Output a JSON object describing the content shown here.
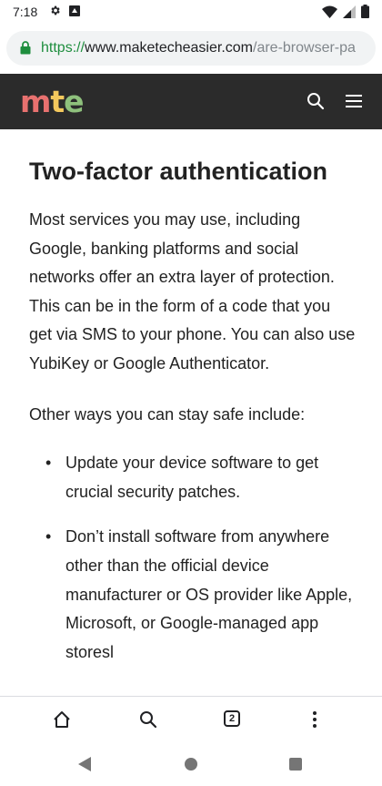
{
  "status_bar": {
    "time": "7:18",
    "left_icons": [
      "gear-icon",
      "download-icon"
    ],
    "right_icons": [
      "wifi-icon",
      "cellular-signal-icon",
      "battery-icon"
    ]
  },
  "browser": {
    "url_scheme": "https://",
    "url_host": "www.maketecheasier.com",
    "url_path": "/are-browser-pa",
    "secure_color": "#1e8e3e",
    "tab_count": "2"
  },
  "site": {
    "logo": {
      "m": "m",
      "t": "t",
      "e": "e"
    },
    "header_bg": "#2b2b2b"
  },
  "article": {
    "heading": "Two-factor authentication",
    "paragraph1": "Most services you may use, including Google, banking platforms and social networks offer an extra layer of protection. This can be in the form of a code that you get via SMS to your phone. You can also use YubiKey or Google Authenticator.",
    "paragraph2": "Other ways you can stay safe include:",
    "bullets": [
      "Update your device software to get crucial security patches.",
      "Don’t install software from anywhere other than the official device manufacturer or OS provider like Apple, Microsoft, or Google-managed app storesl"
    ]
  },
  "bottom_toolbar": {
    "icons": [
      "home-icon",
      "search-icon",
      "tab-switcher-icon",
      "more-vert-icon"
    ]
  },
  "nav_bar": {
    "icons": [
      "back-icon",
      "home-circle-icon",
      "recents-icon"
    ]
  }
}
